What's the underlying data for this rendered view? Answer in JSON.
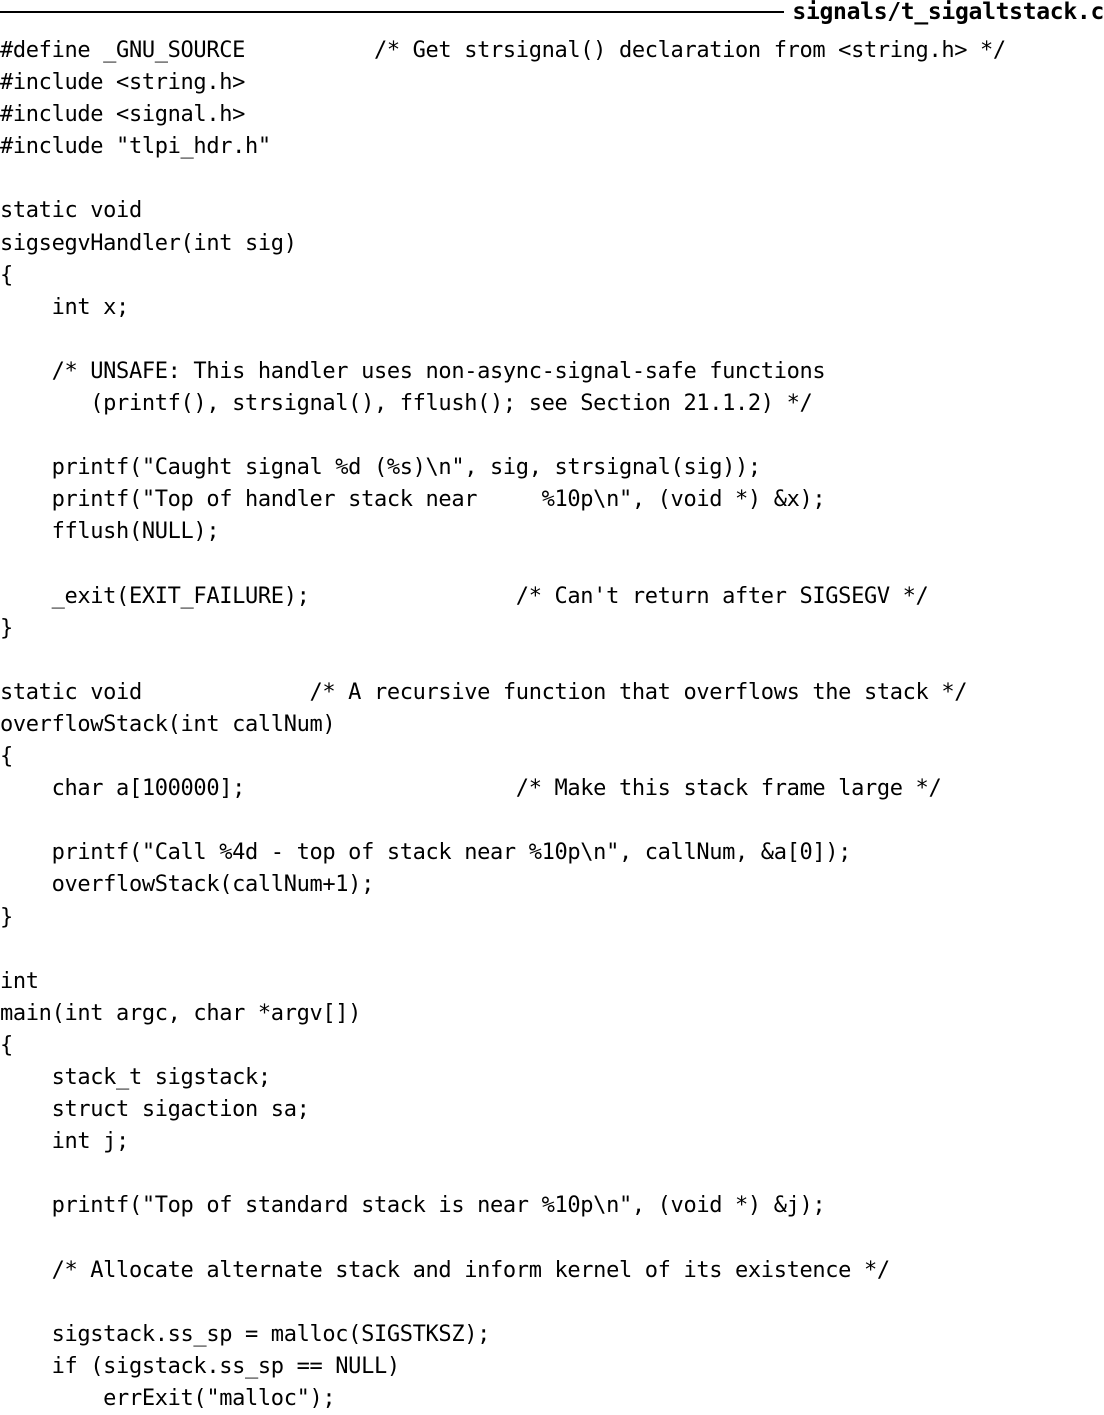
{
  "header": {
    "filename": "signals/t_sigaltstack.c"
  },
  "code_lines": [
    "#define _GNU_SOURCE          /* Get strsignal() declaration from <string.h> */",
    "#include <string.h>",
    "#include <signal.h>",
    "#include \"tlpi_hdr.h\"",
    "",
    "static void",
    "sigsegvHandler(int sig)",
    "{",
    "    int x;",
    "",
    "    /* UNSAFE: This handler uses non-async-signal-safe functions",
    "       (printf(), strsignal(), fflush(); see Section 21.1.2) */",
    "",
    "    printf(\"Caught signal %d (%s)\\n\", sig, strsignal(sig));",
    "    printf(\"Top of handler stack near     %10p\\n\", (void *) &x);",
    "    fflush(NULL);",
    "",
    "    _exit(EXIT_FAILURE);                /* Can't return after SIGSEGV */",
    "}",
    "",
    "static void             /* A recursive function that overflows the stack */",
    "overflowStack(int callNum)",
    "{",
    "    char a[100000];                     /* Make this stack frame large */",
    "",
    "    printf(\"Call %4d - top of stack near %10p\\n\", callNum, &a[0]);",
    "    overflowStack(callNum+1);",
    "}",
    "",
    "int",
    "main(int argc, char *argv[])",
    "{",
    "    stack_t sigstack;",
    "    struct sigaction sa;",
    "    int j;",
    "",
    "    printf(\"Top of standard stack is near %10p\\n\", (void *) &j);",
    "",
    "    /* Allocate alternate stack and inform kernel of its existence */",
    "",
    "    sigstack.ss_sp = malloc(SIGSTKSZ);",
    "    if (sigstack.ss_sp == NULL)",
    "        errExit(\"malloc\");"
  ]
}
